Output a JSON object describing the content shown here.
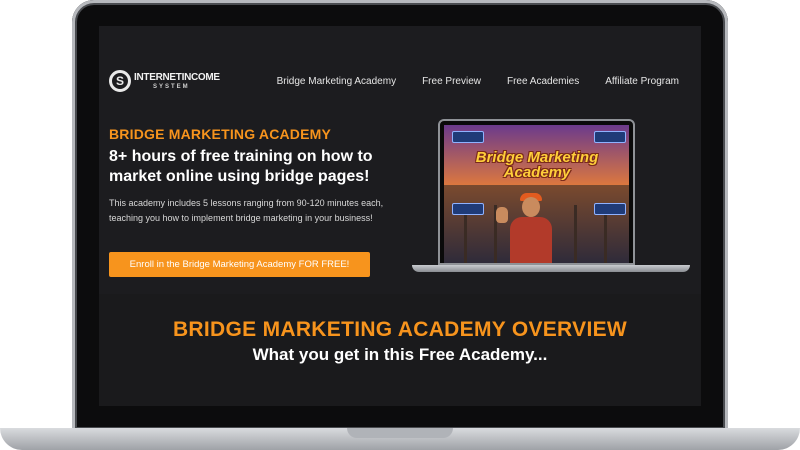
{
  "logo": {
    "mark": "S",
    "main": "INTERNETINCOME",
    "sub": "SYSTEM"
  },
  "nav": {
    "items": [
      {
        "label": "Bridge Marketing Academy"
      },
      {
        "label": "Free Preview"
      },
      {
        "label": "Free Academies"
      },
      {
        "label": "Affiliate Program"
      }
    ]
  },
  "hero": {
    "title": "BRIDGE MARKETING ACADEMY",
    "headline": "8+ hours of free training on how to market online using bridge pages!",
    "description": "This academy includes 5 lessons ranging from 90-120 minutes each, teaching you how to implement bridge marketing in your business!",
    "cta_label": "Enroll in the Bridge Marketing Academy FOR FREE!",
    "image_title": "Bridge Marketing Academy"
  },
  "overview": {
    "title": "BRIDGE MARKETING ACADEMY OVERVIEW",
    "subtitle": "What you get in this Free Academy..."
  },
  "colors": {
    "accent": "#f7941d",
    "background": "#1c1c1f",
    "text": "#ffffff"
  }
}
